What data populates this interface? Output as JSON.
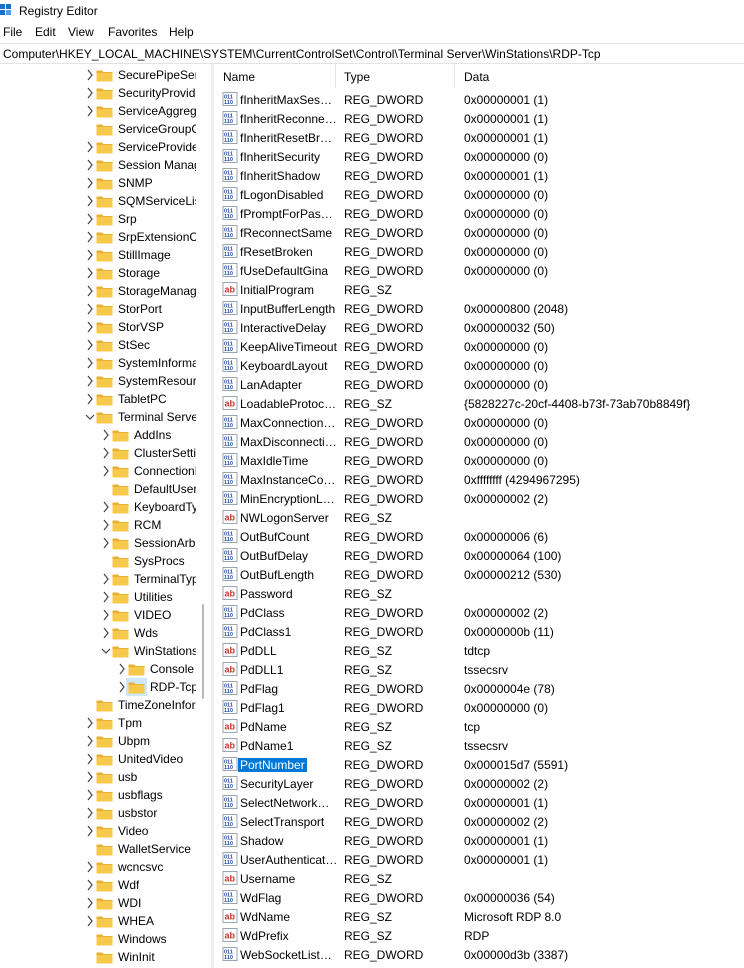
{
  "window": {
    "title": "Registry Editor"
  },
  "menu": [
    "File",
    "Edit",
    "View",
    "Favorites",
    "Help"
  ],
  "address": "Computer\\HKEY_LOCAL_MACHINE\\SYSTEM\\CurrentControlSet\\Control\\Terminal Server\\WinStations\\RDP-Tcp",
  "tree": [
    {
      "label": "SecurePipeServers",
      "depth": 0,
      "exp": "collapsed"
    },
    {
      "label": "SecurityProviders",
      "depth": 0,
      "exp": "collapsed"
    },
    {
      "label": "ServiceAggregatedEvents",
      "depth": 0,
      "exp": "collapsed"
    },
    {
      "label": "ServiceGroupOrder",
      "depth": 0,
      "exp": "none"
    },
    {
      "label": "ServiceProvider",
      "depth": 0,
      "exp": "collapsed"
    },
    {
      "label": "Session Manager",
      "depth": 0,
      "exp": "collapsed"
    },
    {
      "label": "SNMP",
      "depth": 0,
      "exp": "collapsed"
    },
    {
      "label": "SQMServiceList",
      "depth": 0,
      "exp": "collapsed"
    },
    {
      "label": "Srp",
      "depth": 0,
      "exp": "collapsed"
    },
    {
      "label": "SrpExtensionConfig",
      "depth": 0,
      "exp": "collapsed"
    },
    {
      "label": "StillImage",
      "depth": 0,
      "exp": "collapsed"
    },
    {
      "label": "Storage",
      "depth": 0,
      "exp": "collapsed"
    },
    {
      "label": "StorageManagement",
      "depth": 0,
      "exp": "collapsed"
    },
    {
      "label": "StorPort",
      "depth": 0,
      "exp": "collapsed"
    },
    {
      "label": "StorVSP",
      "depth": 0,
      "exp": "collapsed"
    },
    {
      "label": "StSec",
      "depth": 0,
      "exp": "collapsed"
    },
    {
      "label": "SystemInformation",
      "depth": 0,
      "exp": "collapsed"
    },
    {
      "label": "SystemResources",
      "depth": 0,
      "exp": "collapsed"
    },
    {
      "label": "TabletPC",
      "depth": 0,
      "exp": "collapsed"
    },
    {
      "label": "Terminal Server",
      "depth": 0,
      "exp": "expanded"
    },
    {
      "label": "AddIns",
      "depth": 1,
      "exp": "collapsed"
    },
    {
      "label": "ClusterSettings",
      "depth": 1,
      "exp": "collapsed"
    },
    {
      "label": "ConnectionHandler",
      "depth": 1,
      "exp": "collapsed"
    },
    {
      "label": "DefaultUserConfiguration",
      "depth": 1,
      "exp": "none"
    },
    {
      "label": "KeyboardType Mapping",
      "depth": 1,
      "exp": "collapsed"
    },
    {
      "label": "RCM",
      "depth": 1,
      "exp": "collapsed"
    },
    {
      "label": "SessionArbitrationHelper",
      "depth": 1,
      "exp": "collapsed"
    },
    {
      "label": "SysProcs",
      "depth": 1,
      "exp": "none"
    },
    {
      "label": "TerminalTypes",
      "depth": 1,
      "exp": "collapsed"
    },
    {
      "label": "Utilities",
      "depth": 1,
      "exp": "collapsed"
    },
    {
      "label": "VIDEO",
      "depth": 1,
      "exp": "collapsed"
    },
    {
      "label": "Wds",
      "depth": 1,
      "exp": "collapsed"
    },
    {
      "label": "WinStations",
      "depth": 1,
      "exp": "expanded"
    },
    {
      "label": "Console",
      "depth": 2,
      "exp": "collapsed"
    },
    {
      "label": "RDP-Tcp",
      "depth": 2,
      "exp": "collapsed",
      "selected": true
    },
    {
      "label": "TimeZoneInformation",
      "depth": 0,
      "exp": "none"
    },
    {
      "label": "Tpm",
      "depth": 0,
      "exp": "collapsed"
    },
    {
      "label": "Ubpm",
      "depth": 0,
      "exp": "collapsed"
    },
    {
      "label": "UnitedVideo",
      "depth": 0,
      "exp": "collapsed"
    },
    {
      "label": "usb",
      "depth": 0,
      "exp": "collapsed"
    },
    {
      "label": "usbflags",
      "depth": 0,
      "exp": "collapsed"
    },
    {
      "label": "usbstor",
      "depth": 0,
      "exp": "collapsed"
    },
    {
      "label": "Video",
      "depth": 0,
      "exp": "collapsed"
    },
    {
      "label": "WalletService",
      "depth": 0,
      "exp": "none"
    },
    {
      "label": "wcncsvc",
      "depth": 0,
      "exp": "collapsed"
    },
    {
      "label": "Wdf",
      "depth": 0,
      "exp": "collapsed"
    },
    {
      "label": "WDI",
      "depth": 0,
      "exp": "collapsed"
    },
    {
      "label": "WHEA",
      "depth": 0,
      "exp": "collapsed"
    },
    {
      "label": "Windows",
      "depth": 0,
      "exp": "none"
    },
    {
      "label": "WinInit",
      "depth": 0,
      "exp": "none"
    }
  ],
  "columns": {
    "name": "Name",
    "type": "Type",
    "data": "Data"
  },
  "values": [
    {
      "name": "fInheritMaxSessionTime",
      "type": "REG_DWORD",
      "data": "0x00000001 (1)"
    },
    {
      "name": "fInheritReconnectSame",
      "type": "REG_DWORD",
      "data": "0x00000001 (1)"
    },
    {
      "name": "fInheritResetBroken",
      "type": "REG_DWORD",
      "data": "0x00000001 (1)"
    },
    {
      "name": "fInheritSecurity",
      "type": "REG_DWORD",
      "data": "0x00000000 (0)"
    },
    {
      "name": "fInheritShadow",
      "type": "REG_DWORD",
      "data": "0x00000001 (1)"
    },
    {
      "name": "fLogonDisabled",
      "type": "REG_DWORD",
      "data": "0x00000000 (0)"
    },
    {
      "name": "fPromptForPassword",
      "type": "REG_DWORD",
      "data": "0x00000000 (0)"
    },
    {
      "name": "fReconnectSame",
      "type": "REG_DWORD",
      "data": "0x00000000 (0)"
    },
    {
      "name": "fResetBroken",
      "type": "REG_DWORD",
      "data": "0x00000000 (0)"
    },
    {
      "name": "fUseDefaultGina",
      "type": "REG_DWORD",
      "data": "0x00000000 (0)"
    },
    {
      "name": "InitialProgram",
      "type": "REG_SZ",
      "data": ""
    },
    {
      "name": "InputBufferLength",
      "type": "REG_DWORD",
      "data": "0x00000800 (2048)"
    },
    {
      "name": "InteractiveDelay",
      "type": "REG_DWORD",
      "data": "0x00000032 (50)"
    },
    {
      "name": "KeepAliveTimeout",
      "type": "REG_DWORD",
      "data": "0x00000000 (0)"
    },
    {
      "name": "KeyboardLayout",
      "type": "REG_DWORD",
      "data": "0x00000000 (0)"
    },
    {
      "name": "LanAdapter",
      "type": "REG_DWORD",
      "data": "0x00000000 (0)"
    },
    {
      "name": "LoadableProtocol_Object",
      "type": "REG_SZ",
      "data": "{5828227c-20cf-4408-b73f-73ab70b8849f}"
    },
    {
      "name": "MaxConnectionTime",
      "type": "REG_DWORD",
      "data": "0x00000000 (0)"
    },
    {
      "name": "MaxDisconnectionTime",
      "type": "REG_DWORD",
      "data": "0x00000000 (0)"
    },
    {
      "name": "MaxIdleTime",
      "type": "REG_DWORD",
      "data": "0x00000000 (0)"
    },
    {
      "name": "MaxInstanceCount",
      "type": "REG_DWORD",
      "data": "0xffffffff (4294967295)"
    },
    {
      "name": "MinEncryptionLevel",
      "type": "REG_DWORD",
      "data": "0x00000002 (2)"
    },
    {
      "name": "NWLogonServer",
      "type": "REG_SZ",
      "data": ""
    },
    {
      "name": "OutBufCount",
      "type": "REG_DWORD",
      "data": "0x00000006 (6)"
    },
    {
      "name": "OutBufDelay",
      "type": "REG_DWORD",
      "data": "0x00000064 (100)"
    },
    {
      "name": "OutBufLength",
      "type": "REG_DWORD",
      "data": "0x00000212 (530)"
    },
    {
      "name": "Password",
      "type": "REG_SZ",
      "data": ""
    },
    {
      "name": "PdClass",
      "type": "REG_DWORD",
      "data": "0x00000002 (2)"
    },
    {
      "name": "PdClass1",
      "type": "REG_DWORD",
      "data": "0x0000000b (11)"
    },
    {
      "name": "PdDLL",
      "type": "REG_SZ",
      "data": "tdtcp"
    },
    {
      "name": "PdDLL1",
      "type": "REG_SZ",
      "data": "tssecsrv"
    },
    {
      "name": "PdFlag",
      "type": "REG_DWORD",
      "data": "0x0000004e (78)"
    },
    {
      "name": "PdFlag1",
      "type": "REG_DWORD",
      "data": "0x00000000 (0)"
    },
    {
      "name": "PdName",
      "type": "REG_SZ",
      "data": "tcp"
    },
    {
      "name": "PdName1",
      "type": "REG_SZ",
      "data": "tssecsrv"
    },
    {
      "name": "PortNumber",
      "type": "REG_DWORD",
      "data": "0x000015d7 (5591)",
      "selected": true
    },
    {
      "name": "SecurityLayer",
      "type": "REG_DWORD",
      "data": "0x00000002 (2)"
    },
    {
      "name": "SelectNetworkDetect",
      "type": "REG_DWORD",
      "data": "0x00000001 (1)"
    },
    {
      "name": "SelectTransport",
      "type": "REG_DWORD",
      "data": "0x00000002 (2)"
    },
    {
      "name": "Shadow",
      "type": "REG_DWORD",
      "data": "0x00000001 (1)"
    },
    {
      "name": "UserAuthentication",
      "type": "REG_DWORD",
      "data": "0x00000001 (1)"
    },
    {
      "name": "Username",
      "type": "REG_SZ",
      "data": ""
    },
    {
      "name": "WdFlag",
      "type": "REG_DWORD",
      "data": "0x00000036 (54)"
    },
    {
      "name": "WdName",
      "type": "REG_SZ",
      "data": "Microsoft RDP 8.0"
    },
    {
      "name": "WdPrefix",
      "type": "REG_SZ",
      "data": "RDP"
    },
    {
      "name": "WebSocketListenerPort",
      "type": "REG_DWORD",
      "data": "0x00000d3b (3387)"
    }
  ],
  "colors": {
    "folder": "#f7c94a",
    "folder_dark": "#e6b030",
    "selection": "#0078d7",
    "dword_icon": "#1f4ea8",
    "sz_icon": "#c0392b"
  }
}
